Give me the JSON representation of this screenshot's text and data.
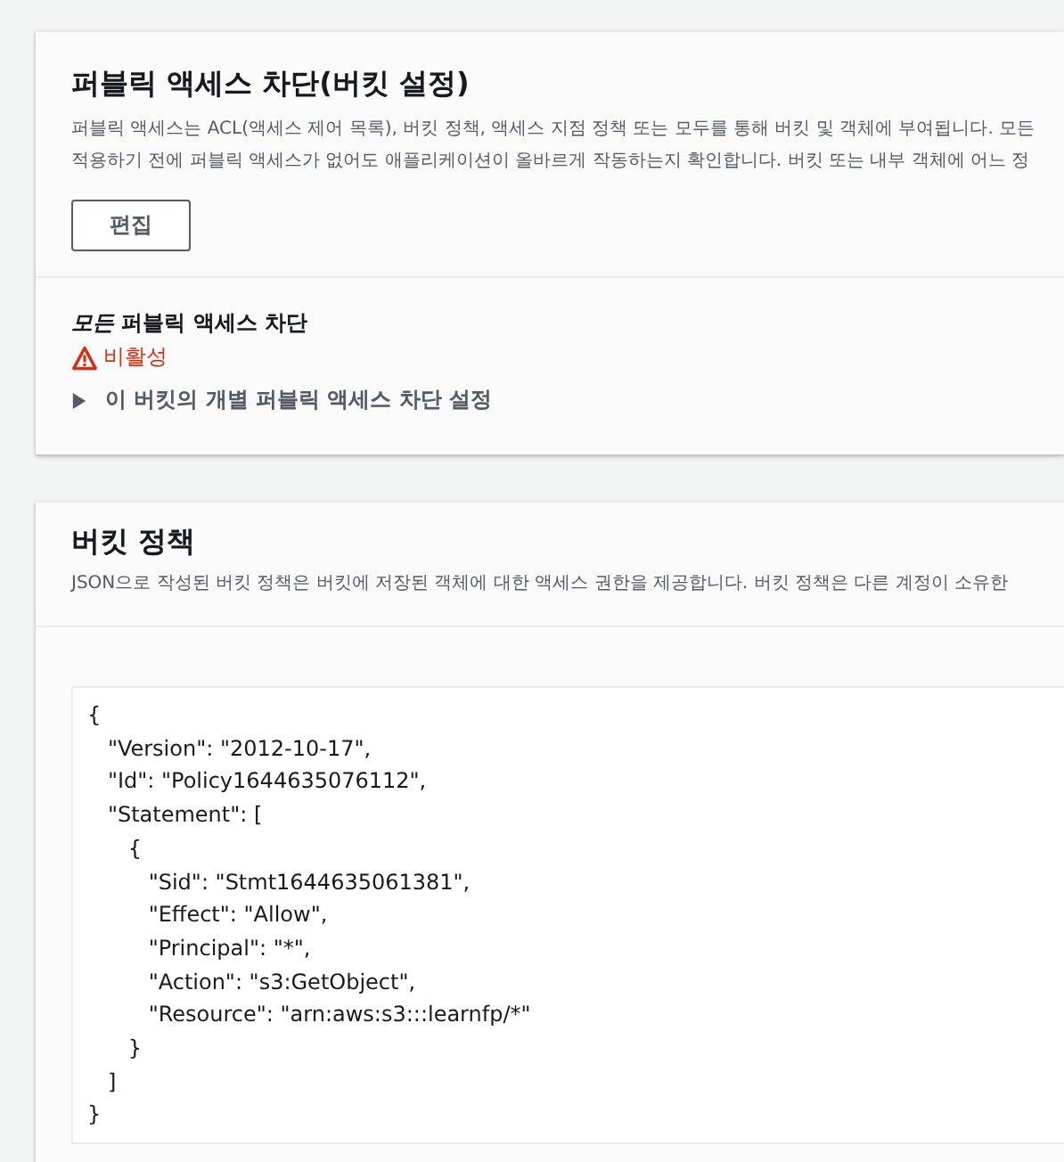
{
  "block_public_access": {
    "title": "퍼블릭 액세스 차단(버킷 설정)",
    "description_lines": [
      "퍼블릭 액세스는 ACL(액세스 제어 목록), 버킷 정책, 액세스 지점 정책 또는 모두를 통해 버킷 및 객체에 부여됩니다. 모든",
      "적용하기 전에 퍼블릭 액세스가 없어도 애플리케이션이 올바르게 작동하는지 확인합니다. 버킷 또는 내부 객체에 어느 정"
    ],
    "edit_button": "편집",
    "setting_label": "*모든* 퍼블릭 액세스 차단",
    "status": {
      "text": "비활성",
      "kind": "warning"
    },
    "details": {
      "label": "이 버킷의 개별 퍼블릭 액세스 차단 설정",
      "expanded": false
    }
  },
  "bucket_policy": {
    "title": "버킷 정책",
    "description": "JSON으로 작성된 버킷 정책은 버킷에 저장된 객체에 대한 액세스 권한을 제공합니다. 버킷 정책은 다른 계정이 소유한",
    "code_lines": [
      "{",
      "   \"Version\": \"2012-10-17\",",
      "   \"Id\": \"Policy1644635076112\",",
      "   \"Statement\": [",
      "      {",
      "         \"Sid\": \"Stmt1644635061381\",",
      "         \"Effect\": \"Allow\",",
      "         \"Principal\": \"*\",",
      "         \"Action\": \"s3:GetObject\",",
      "         \"Resource\": \"arn:aws:s3:::learnfp/*\"",
      "      }",
      "   ]",
      "}"
    ]
  }
}
